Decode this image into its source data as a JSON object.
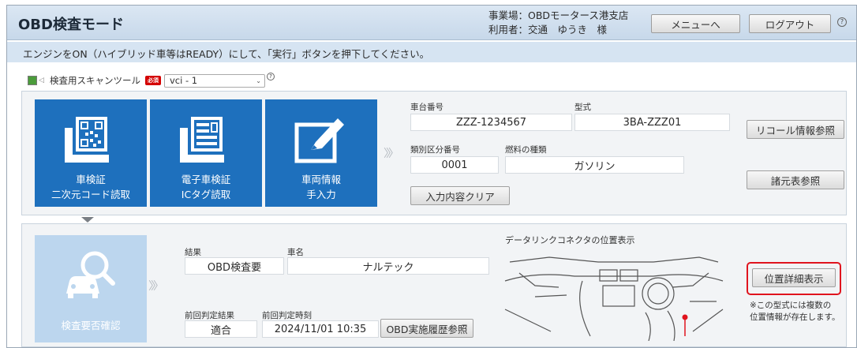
{
  "header": {
    "title": "OBD検査モード",
    "office_line": "事業場：OBDモータース港支店",
    "user_line": "利用者：交通　ゆうき　様",
    "menu_label": "メニューへ",
    "logout_label": "ログアウト",
    "help_glyph": "?"
  },
  "notice": "エンジンをON（ハイブリッド車等はREADY）にして、「実行」ボタンを押下してください。",
  "scan_tool": {
    "label": "検査用スキャンツール",
    "required_badge": "必須",
    "selected": "vci - 1",
    "status_color": "#4b9c3b"
  },
  "tiles": [
    {
      "line1": "車検証",
      "line2": "二次元コード読取",
      "icon": "qr-certificate-icon"
    },
    {
      "line1": "電子車検証",
      "line2": "ICタグ読取",
      "icon": "ic-certificate-icon"
    },
    {
      "line1": "車両情報",
      "line2": "手入力",
      "icon": "pen-edit-icon"
    }
  ],
  "vehicle": {
    "chassis_label": "車台番号",
    "chassis_value": "ZZZ-1234567",
    "model_label": "型式",
    "model_value": "3BA-ZZZ01",
    "category_label": "類別区分番号",
    "category_value": "0001",
    "fuel_label": "燃料の種類",
    "fuel_value": "ガソリン",
    "clear_button": "入力内容クリア",
    "recall_button": "リコール情報参照",
    "spec_button": "諸元表参照"
  },
  "inspection": {
    "tile_label": "検査要否確認",
    "result_label": "結果",
    "result_value": "OBD検査要",
    "car_name_label": "車名",
    "car_name_value": "ナルテック",
    "prev_result_label": "前回判定結果",
    "prev_result_value": "適合",
    "prev_time_label": "前回判定時刻",
    "prev_time_value": "2024/11/01 10:35",
    "history_button": "OBD実施履歴参照",
    "connector_title": "データリンクコネクタの位置表示",
    "detail_button": "位置詳細表示",
    "note_line1": "※この型式には複数の",
    "note_line2": "位置情報が存在します。"
  },
  "colors": {
    "tile_blue": "#1e70bd",
    "tile_disabled": "#bcd6ee",
    "highlight_red": "#e0141e"
  }
}
